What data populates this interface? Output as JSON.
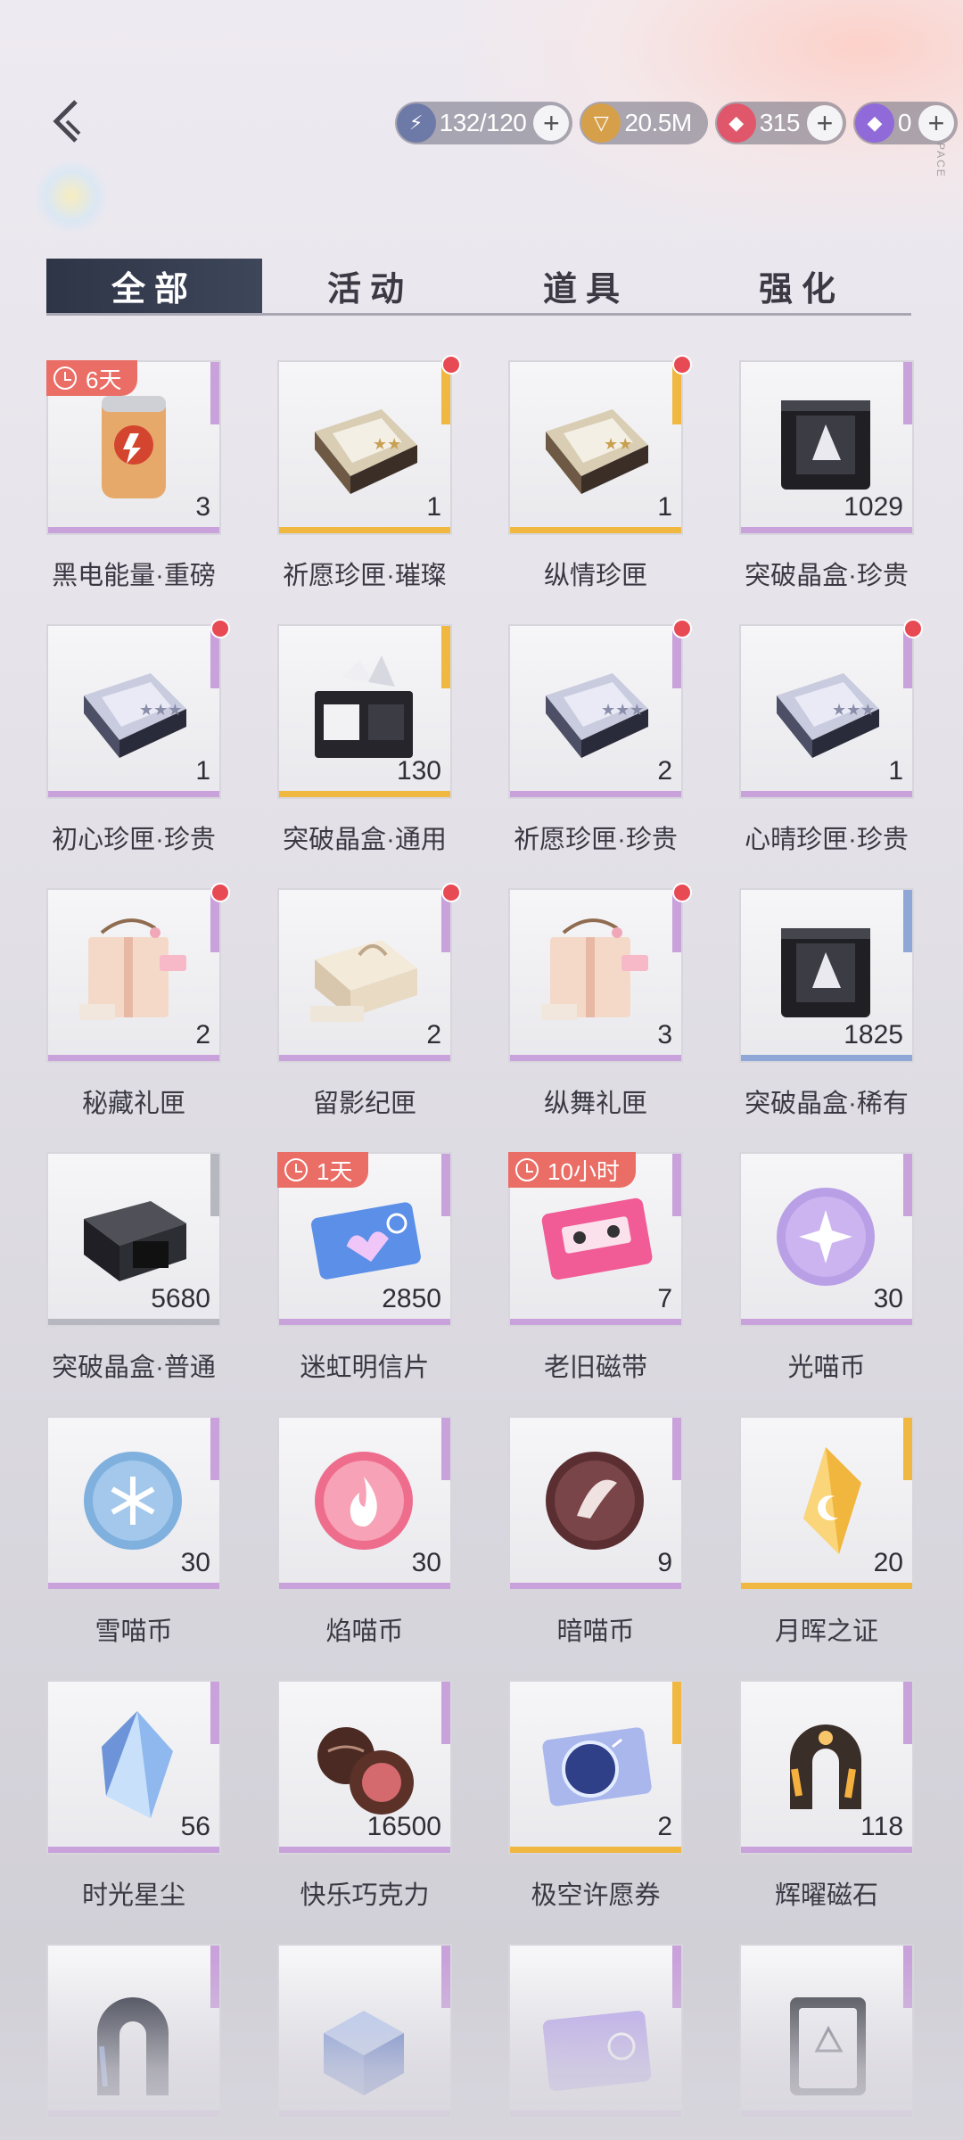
{
  "header": {
    "resources": [
      {
        "id": "stamina",
        "icon": "lightning-icon",
        "value": "132/120",
        "color": "#6d7aa8",
        "has_plus": true
      },
      {
        "id": "gold",
        "icon": "gold-coin-icon",
        "value": "20.5M",
        "color": "#d6a04a",
        "has_plus": false
      },
      {
        "id": "ruby",
        "icon": "red-gem-icon",
        "value": "315",
        "color": "#e0566a",
        "has_plus": true
      },
      {
        "id": "diamond",
        "icon": "purple-diamond-icon",
        "value": "0",
        "color": "#8f6ad8",
        "has_plus": true
      }
    ],
    "plus_label": "+",
    "side_tag": "SPACE"
  },
  "tabs": [
    {
      "label": "全部",
      "active": true
    },
    {
      "label": "活动",
      "active": false
    },
    {
      "label": "道具",
      "active": false
    },
    {
      "label": "强化",
      "active": false
    }
  ],
  "items": [
    {
      "name": "黑电能量·重磅",
      "count": "3",
      "icon": "energy-can-icon",
      "rarity": "purple",
      "timer": "6天",
      "dot": false
    },
    {
      "name": "祈愿珍匣·璀璨",
      "count": "1",
      "icon": "gold-box-icon",
      "rarity": "gold",
      "timer": null,
      "dot": true
    },
    {
      "name": "纵情珍匣",
      "count": "1",
      "icon": "gold-box-icon",
      "rarity": "gold",
      "timer": null,
      "dot": true
    },
    {
      "name": "突破晶盒·珍贵",
      "count": "1029",
      "icon": "crystal-crate-icon",
      "rarity": "purple",
      "timer": null,
      "dot": false
    },
    {
      "name": "初心珍匣·珍贵",
      "count": "1",
      "icon": "silver-box-icon",
      "rarity": "purple",
      "timer": null,
      "dot": true
    },
    {
      "name": "突破晶盒·通用",
      "count": "130",
      "icon": "open-crate-icon",
      "rarity": "gold",
      "timer": null,
      "dot": false
    },
    {
      "name": "祈愿珍匣·珍贵",
      "count": "2",
      "icon": "silver-box-icon",
      "rarity": "purple",
      "timer": null,
      "dot": true
    },
    {
      "name": "心晴珍匣·珍贵",
      "count": "1",
      "icon": "silver-box-icon",
      "rarity": "purple",
      "timer": null,
      "dot": true
    },
    {
      "name": "秘藏礼匣",
      "count": "2",
      "icon": "gift-box-icon",
      "rarity": "purple",
      "timer": null,
      "dot": true
    },
    {
      "name": "留影纪匣",
      "count": "2",
      "icon": "keepsake-box-icon",
      "rarity": "purple",
      "timer": null,
      "dot": true
    },
    {
      "name": "纵舞礼匣",
      "count": "3",
      "icon": "gift-box-icon",
      "rarity": "purple",
      "timer": null,
      "dot": true
    },
    {
      "name": "突破晶盒·稀有",
      "count": "1825",
      "icon": "crystal-crate-icon",
      "rarity": "blue",
      "timer": null,
      "dot": false
    },
    {
      "name": "突破晶盒·普通",
      "count": "5680",
      "icon": "plain-crate-icon",
      "rarity": "grey",
      "timer": null,
      "dot": false
    },
    {
      "name": "迷虹明信片",
      "count": "2850",
      "icon": "postcard-icon",
      "rarity": "purple",
      "timer": "1天",
      "dot": false
    },
    {
      "name": "老旧磁带",
      "count": "7",
      "icon": "cassette-icon",
      "rarity": "purple",
      "timer": "10小时",
      "dot": false
    },
    {
      "name": "光喵币",
      "count": "30",
      "icon": "light-coin-icon",
      "rarity": "purple",
      "timer": null,
      "dot": false
    },
    {
      "name": "雪喵币",
      "count": "30",
      "icon": "snow-coin-icon",
      "rarity": "purple",
      "timer": null,
      "dot": false
    },
    {
      "name": "焰喵币",
      "count": "30",
      "icon": "flame-coin-icon",
      "rarity": "purple",
      "timer": null,
      "dot": false
    },
    {
      "name": "暗喵币",
      "count": "9",
      "icon": "dark-coin-icon",
      "rarity": "purple",
      "timer": null,
      "dot": false
    },
    {
      "name": "月晖之证",
      "count": "20",
      "icon": "moon-crystal-icon",
      "rarity": "gold",
      "timer": null,
      "dot": false
    },
    {
      "name": "时光星尘",
      "count": "56",
      "icon": "stardust-crystal-icon",
      "rarity": "purple",
      "timer": null,
      "dot": false
    },
    {
      "name": "快乐巧克力",
      "count": "16500",
      "icon": "chocolate-icon",
      "rarity": "purple",
      "timer": null,
      "dot": false
    },
    {
      "name": "极空许愿券",
      "count": "2",
      "icon": "wish-ticket-icon",
      "rarity": "gold",
      "timer": null,
      "dot": false
    },
    {
      "name": "辉曜磁石",
      "count": "118",
      "icon": "gold-magnet-icon",
      "rarity": "purple",
      "timer": null,
      "dot": false
    },
    {
      "name": "",
      "count": "",
      "icon": "dark-magnet-icon",
      "rarity": "purple",
      "timer": null,
      "dot": false
    },
    {
      "name": "",
      "count": "",
      "icon": "blue-cube-icon",
      "rarity": "purple",
      "timer": null,
      "dot": false
    },
    {
      "name": "",
      "count": "",
      "icon": "purple-ticket-icon",
      "rarity": "purple",
      "timer": null,
      "dot": false
    },
    {
      "name": "",
      "count": "",
      "icon": "card-device-icon",
      "rarity": "purple",
      "timer": null,
      "dot": false
    }
  ],
  "rarity_colors": {
    "purple": "#c9a2db",
    "gold": "#f0b840",
    "blue": "#8fa7d6",
    "grey": "#b7b7bf"
  }
}
